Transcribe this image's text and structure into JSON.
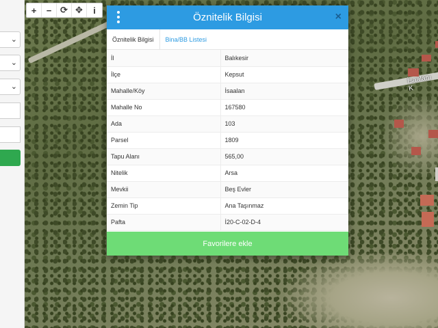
{
  "toolbar": {
    "zoom_in": "+",
    "zoom_out": "−",
    "refresh": "⟳",
    "move": "✥",
    "info": "i"
  },
  "map": {
    "place_label": "İsaalanı K"
  },
  "dialog": {
    "title": "Öznitelik Bilgisi",
    "close": "×",
    "tabs": [
      {
        "label": "Öznitelik Bilgisi",
        "active": true
      },
      {
        "label": "Bina/BB Listesi",
        "active": false
      }
    ],
    "rows": [
      {
        "key": "İl",
        "value": "Balıkesir"
      },
      {
        "key": "İlçe",
        "value": "Kepsut"
      },
      {
        "key": "Mahalle/Köy",
        "value": "İsaalan"
      },
      {
        "key": "Mahalle No",
        "value": "167580"
      },
      {
        "key": "Ada",
        "value": "103"
      },
      {
        "key": "Parsel",
        "value": "1809"
      },
      {
        "key": "Tapu Alanı",
        "value": "565,00"
      },
      {
        "key": "Nitelik",
        "value": "Arsa"
      },
      {
        "key": "Mevkii",
        "value": "Beş Evler"
      },
      {
        "key": "Zemin Tip",
        "value": "Ana Taşınmaz"
      },
      {
        "key": "Pafta",
        "value": "İ20-C-02-D-4"
      }
    ],
    "favorite_button": "Favorilere ekle"
  },
  "colors": {
    "header": "#2d9be2",
    "favorite": "#6edc76",
    "left_button": "#2fa84f"
  }
}
